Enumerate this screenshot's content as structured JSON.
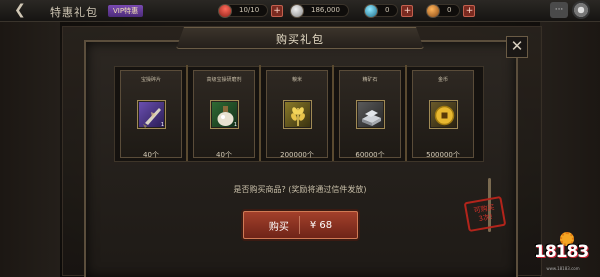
{
  "topbar": {
    "back": "❮",
    "title": "特惠礼包",
    "vip_tag": "VIP特惠",
    "resources": [
      {
        "name": "stamina",
        "value": "10/10"
      },
      {
        "name": "silver",
        "value": "186,000"
      },
      {
        "name": "gem",
        "value": "0"
      },
      {
        "name": "food",
        "value": "0"
      }
    ],
    "add": "+",
    "chat": "···"
  },
  "dialog": {
    "title": "购买礼包",
    "close": "✕",
    "items": [
      {
        "name": "宝操碎片",
        "qty": "40个",
        "count": "1",
        "icon": "weapon-fragment-icon"
      },
      {
        "name": "高级宝操研磨剂",
        "qty": "40个",
        "count": "1",
        "icon": "polishing-potion-icon"
      },
      {
        "name": "粮米",
        "qty": "200000个",
        "count": "",
        "icon": "wheat-icon"
      },
      {
        "name": "精矿石",
        "qty": "60000个",
        "count": "",
        "icon": "ore-icon"
      },
      {
        "name": "金币",
        "qty": "500000个",
        "count": "",
        "icon": "gold-coin-icon"
      }
    ],
    "prompt": "是否购买商品? (奖励将通过信件发放)",
    "buy": {
      "label": "购买",
      "price": "¥ 68"
    },
    "limit_line1": "可购买",
    "limit_line2": "3次!"
  },
  "watermark": {
    "text": "18183",
    "url": "www.18183.com"
  },
  "colors": {
    "accent": "#a3402b",
    "gold": "#d6b24a",
    "frame": "#5a4c39"
  }
}
